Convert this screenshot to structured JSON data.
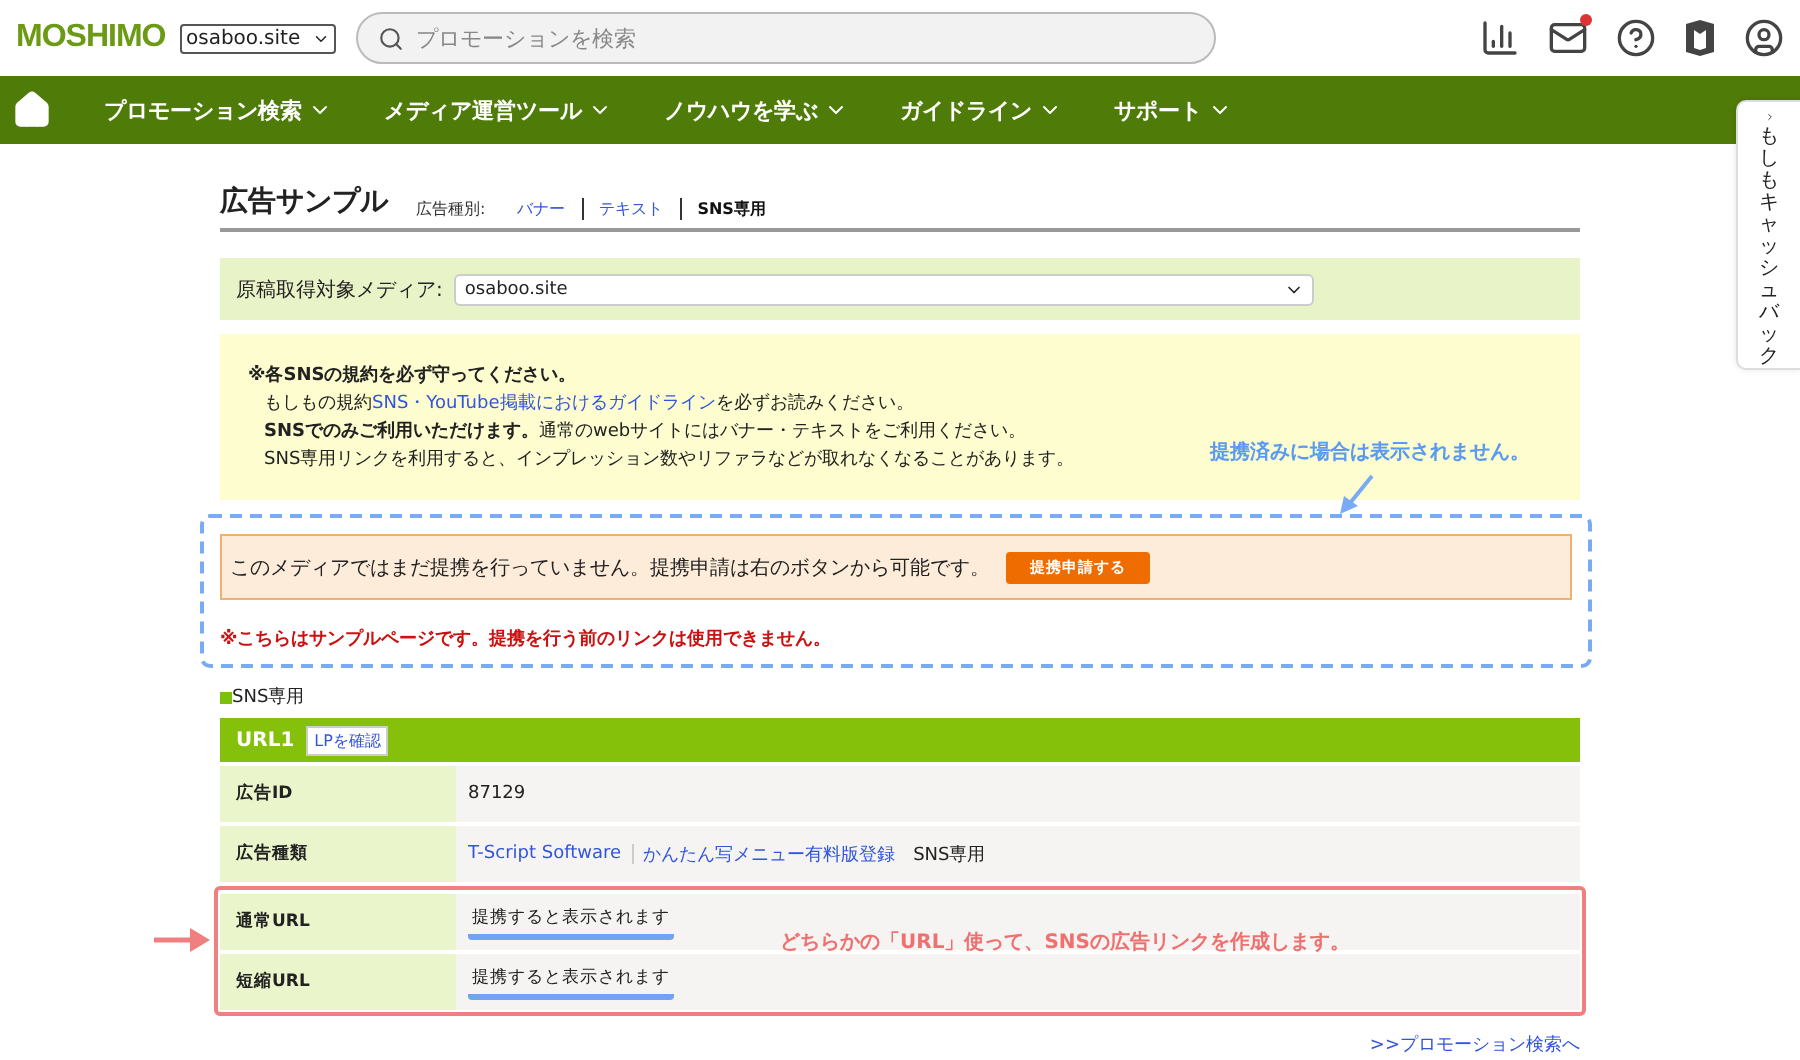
{
  "header": {
    "logo": "MOSHIMO",
    "site_select": "osaboo.site",
    "search": {
      "placeholder": "プロモーションを検索"
    },
    "mail_unread": true
  },
  "nav": {
    "items": [
      "プロモーション検索",
      "メディア運営ツール",
      "ノウハウを学ぶ",
      "ガイドライン",
      "サポート"
    ]
  },
  "side_tab": {
    "label": "もしもキャッシュバック"
  },
  "page": {
    "title": "広告サンプル",
    "type_label": "広告種別:",
    "type_tabs": [
      {
        "label": "バナー",
        "selected": false
      },
      {
        "label": "テキスト",
        "selected": false
      },
      {
        "label": "SNS専用",
        "selected": true
      }
    ]
  },
  "media": {
    "label": "原稿取得対象メディア:",
    "value": "osaboo.site"
  },
  "notice": {
    "lines": [
      [
        {
          "kind": "bold",
          "text": "※各SNSの規約を必ず守ってください。"
        }
      ],
      [
        {
          "kind": "plain",
          "text": "もしもの規約"
        },
        {
          "kind": "link",
          "text": "SNS・YouTube掲載におけるガイドライン"
        },
        {
          "kind": "plain",
          "text": "を必ずお読みください。"
        }
      ],
      [
        {
          "kind": "bold",
          "text": "SNSでのみご利用いただけます。"
        },
        {
          "kind": "plain",
          "text": "通常のwebサイトにはバナー・テキストをご利用ください。"
        }
      ],
      [
        {
          "kind": "plain",
          "text": "SNS専用リンクを利用すると、インプレッション数やリファラなどが取れなくなることがあります。"
        }
      ]
    ]
  },
  "partnership": {
    "message": "このメディアではまだ提携を行っていません。提携申請は右のボタンから可能です。",
    "button": "提携申請する",
    "warning": "※こちらはサンプルページです。提携を行う前のリンクは使用できません。"
  },
  "annotations": {
    "hidden_note": "提携済みに場合は表示されません。",
    "url_note": "どちらかの「URL」使って、SNSの広告リンクを作成します。"
  },
  "section": {
    "label": "SNS専用",
    "header": "URL1",
    "lp_button": "LPを確認"
  },
  "rows": [
    {
      "label": "広告ID",
      "kind": "text",
      "values": [
        "87129"
      ]
    },
    {
      "label": "広告種類",
      "kind": "links",
      "values": [
        "T-Script Software",
        "かんたん写メニュー有料版登録"
      ],
      "suffix": "SNS専用"
    },
    {
      "label": "通常URL",
      "kind": "pending",
      "values": [
        "提携すると表示されます"
      ]
    },
    {
      "label": "短縮URL",
      "kind": "pending",
      "values": [
        "提携すると表示されます"
      ]
    }
  ],
  "footer_link": ">>プロモーション検索へ"
}
